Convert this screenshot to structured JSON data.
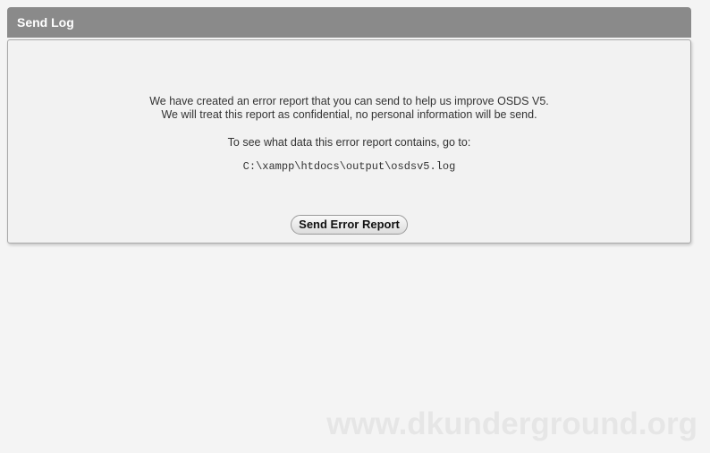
{
  "panel": {
    "title": "Send Log"
  },
  "message": {
    "line1": "We have created an error report that you can send to help us improve OSDS V5.",
    "line2": "We will treat this report as confidential, no personal information will be send.",
    "see_text": "To see what data this error report contains, go to:",
    "log_path": "C:\\xampp\\htdocs\\output\\osdsv5.log"
  },
  "actions": {
    "send_label": "Send Error Report"
  },
  "watermark": "www.dkunderground.org",
  "colors": {
    "header_bg": "#8a8a8a",
    "page_bg": "#f4f4f4"
  }
}
